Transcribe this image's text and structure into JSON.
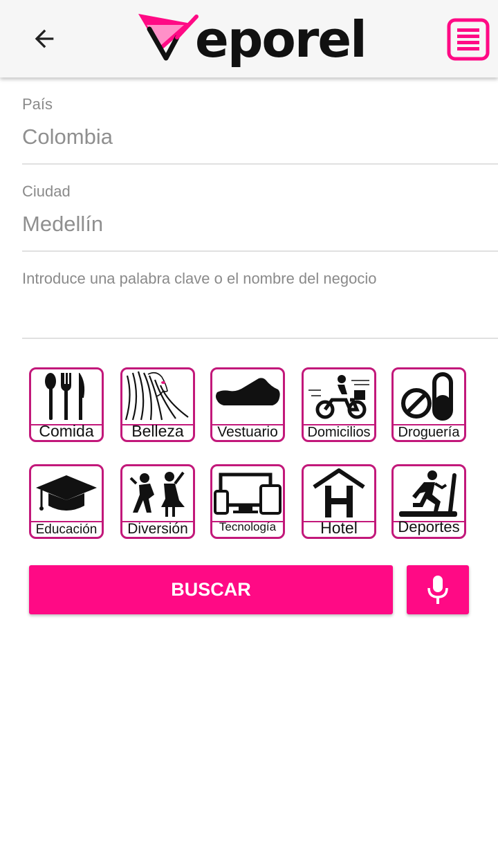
{
  "header": {
    "logo_text": "eporel",
    "back_icon": "arrow-left-icon",
    "menu_icon": "list-menu-icon",
    "brand_color": "#ff0a85"
  },
  "form": {
    "country": {
      "label": "País",
      "value": "Colombia"
    },
    "city": {
      "label": "Ciudad",
      "value": "Medellín"
    },
    "keyword": {
      "placeholder": "Introduce una palabra clave o el nombre del negocio"
    }
  },
  "categories": [
    {
      "label": "Comida",
      "icon": "cutlery-icon"
    },
    {
      "label": "Belleza",
      "icon": "woman-hair-icon"
    },
    {
      "label": "Vestuario",
      "icon": "shoe-icon"
    },
    {
      "label": "Domicilios",
      "icon": "delivery-moto-icon"
    },
    {
      "label": "Droguería",
      "icon": "pills-icon"
    },
    {
      "label": "Educación",
      "icon": "graduation-cap-icon"
    },
    {
      "label": "Diversión",
      "icon": "dancers-icon"
    },
    {
      "label": "Tecnología",
      "icon": "devices-icon"
    },
    {
      "label": "Hotel",
      "icon": "hotel-icon"
    },
    {
      "label": "Deportes",
      "icon": "treadmill-runner-icon"
    }
  ],
  "actions": {
    "search_label": "BUSCAR",
    "mic_icon": "microphone-icon"
  }
}
